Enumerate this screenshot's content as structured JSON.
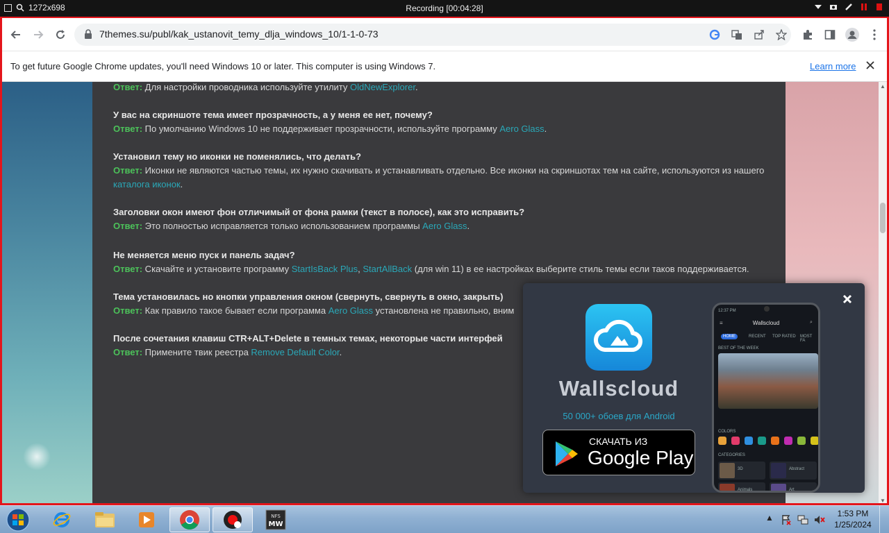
{
  "recorder": {
    "size": "1272x698",
    "title": "Recording [00:04:28]"
  },
  "browser": {
    "url": "7themes.su/publ/kak_ustanovit_temy_dlja_windows_10/1-1-0-73",
    "infobar": {
      "message": "To get future Google Chrome updates, you'll need Windows 10 or later. This computer is using Windows 7.",
      "learn_more": "Learn more"
    }
  },
  "faq": [
    {
      "question": "",
      "answer_label": "Ответ:",
      "parts": [
        {
          "t": " Для настройки проводника используйте утилиту "
        },
        {
          "t": "OldNewExplorer",
          "link": true
        },
        {
          "t": "."
        }
      ]
    },
    {
      "question": "У вас на скриншоте тема имеет прозрачность, а у меня ее нет, почему?",
      "answer_label": "Ответ:",
      "parts": [
        {
          "t": " По умолчанию Windows 10 не поддерживает прозрачности, используйте программу "
        },
        {
          "t": "Aero Glass",
          "link": true
        },
        {
          "t": "."
        }
      ]
    },
    {
      "question": "Установил тему но иконки не поменялись, что делать?",
      "answer_label": "Ответ:",
      "parts": [
        {
          "t": " Иконки не являются частью темы, их нужно скачивать и устанавливать отдельно. Все иконки на скриншотах тем на сайте, используются из нашего "
        },
        {
          "t": "каталога иконок",
          "link": true
        },
        {
          "t": "."
        }
      ]
    },
    {
      "question": "Заголовки окон имеют фон отличимый от фона рамки (текст в полосе), как это исправить?",
      "answer_label": "Ответ:",
      "parts": [
        {
          "t": " Это полностью исправляется только использованием программы "
        },
        {
          "t": "Aero Glass",
          "link": true
        },
        {
          "t": "."
        }
      ]
    },
    {
      "question": "Не меняется меню пуск и панель задач?",
      "answer_label": "Ответ:",
      "parts": [
        {
          "t": " Скачайте и установите программу "
        },
        {
          "t": "StartIsBack Plus",
          "link": true
        },
        {
          "t": ", "
        },
        {
          "t": "StartAllBack",
          "link": true
        },
        {
          "t": " (для win 11) в ее настройках выберите стиль темы если таков поддерживается."
        }
      ]
    },
    {
      "question": "Тема установилась но кнопки управления окном (свернуть, свернуть в окно, закрыть)",
      "answer_label": "Ответ:",
      "parts": [
        {
          "t": " Как правило такое бывает если программа "
        },
        {
          "t": "Aero Glass",
          "link": true
        },
        {
          "t": " установлена не правильно, вним"
        }
      ]
    },
    {
      "question": "После сочетания клавиш CTR+ALT+Delete в темных темах, некоторые части интерфей",
      "answer_label": "Ответ:",
      "parts": [
        {
          "t": " Примените твик реестра "
        },
        {
          "t": "Remove Default Color",
          "link": true
        },
        {
          "t": "."
        }
      ]
    }
  ],
  "ad": {
    "app_name": "Wallscloud",
    "subtitle": "50 000+ обоев для Android",
    "button_small": "СКАЧАТЬ ИЗ",
    "button_big": "Google Play",
    "phone": {
      "time": "12:37 PM",
      "title": "Wallscloud",
      "tabs": [
        "HOME",
        "RECENT",
        "TOP RATED",
        "MOST FA"
      ],
      "best_label": "BEST OF THE WEEK",
      "colors_label": "COLORS",
      "categories_label": "CATEGORIES",
      "categories": [
        "3D",
        "Abstract",
        "Animals",
        "Art"
      ],
      "swatches": [
        "#e8a23a",
        "#e23b6b",
        "#2f8fe0",
        "#1a9a8a",
        "#e8721a",
        "#c02cb0",
        "#8ab83a",
        "#d6c21a"
      ]
    }
  },
  "taskbar": {
    "time": "1:53 PM",
    "date": "1/25/2024"
  }
}
